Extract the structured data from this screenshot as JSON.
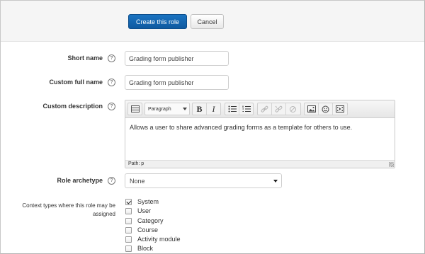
{
  "actions": {
    "create_label": "Create this role",
    "cancel_label": "Cancel"
  },
  "form": {
    "short_name": {
      "label": "Short name",
      "value": "Grading form publisher"
    },
    "full_name": {
      "label": "Custom full name",
      "value": "Grading form publisher"
    },
    "description": {
      "label": "Custom description",
      "format_select": "Paragraph",
      "text": "Allows a user to share advanced grading forms as a template for others to use.",
      "path": "Path: p"
    },
    "archetype": {
      "label": "Role archetype",
      "selected": "None"
    },
    "context": {
      "label": "Context types where this role may be assigned",
      "options": [
        {
          "label": "System",
          "checked": true
        },
        {
          "label": "User",
          "checked": false
        },
        {
          "label": "Category",
          "checked": false
        },
        {
          "label": "Course",
          "checked": false
        },
        {
          "label": "Activity module",
          "checked": false
        },
        {
          "label": "Block",
          "checked": false
        }
      ]
    }
  },
  "help_icon_glyph": "?",
  "colors": {
    "primary": "#0f5aa0",
    "background": "#ffffff",
    "topbar": "#f5f5f5"
  }
}
